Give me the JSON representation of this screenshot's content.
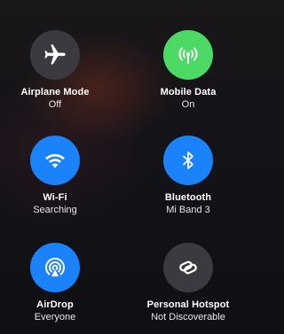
{
  "control_center": {
    "tiles": [
      {
        "title": "Airplane Mode",
        "status": "Off",
        "icon": "airplane-icon",
        "state": "off"
      },
      {
        "title": "Mobile Data",
        "status": "On",
        "icon": "antenna-icon",
        "state": "on",
        "color": "#4cd964"
      },
      {
        "title": "Wi-Fi",
        "status": "Searching",
        "icon": "wifi-icon",
        "state": "on",
        "color": "#1a82fb"
      },
      {
        "title": "Bluetooth",
        "status": "Mi Band 3",
        "icon": "bluetooth-icon",
        "state": "on",
        "color": "#1a82fb"
      },
      {
        "title": "AirDrop",
        "status": "Everyone",
        "icon": "airdrop-icon",
        "state": "on",
        "color": "#1a82fb"
      },
      {
        "title": "Personal Hotspot",
        "status": "Not Discoverable",
        "icon": "hotspot-link-icon",
        "state": "off"
      }
    ]
  }
}
